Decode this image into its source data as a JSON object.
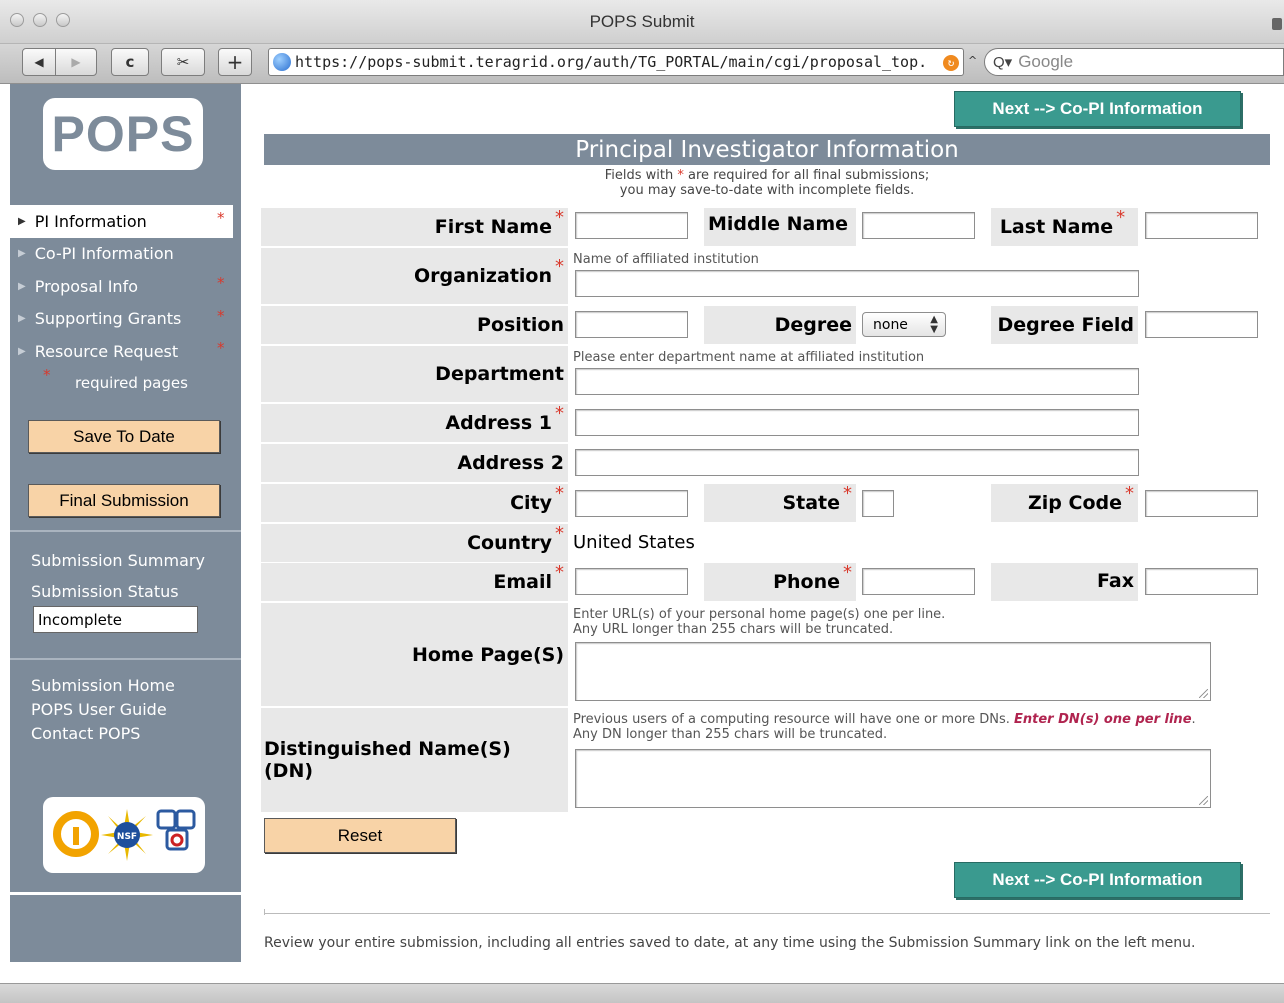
{
  "window": {
    "title": "POPS Submit"
  },
  "toolbar": {
    "back_glyph": "◀",
    "forward_glyph": "▶",
    "reload_glyph": "c",
    "snap_glyph": "✂",
    "add_glyph": "+",
    "url": "https://pops-submit.teragrid.org/auth/TG_PORTAL/main/cgi/proposal_top.",
    "search_placeholder": "Google",
    "search_glyph": "Q▾"
  },
  "sidebar": {
    "logo": "POPS",
    "nav": [
      {
        "label": "PI Information",
        "required": true,
        "active": true
      },
      {
        "label": "Co-PI Information",
        "required": false,
        "active": false
      },
      {
        "label": "Proposal Info",
        "required": true,
        "active": false
      },
      {
        "label": "Supporting Grants",
        "required": true,
        "active": false
      },
      {
        "label": "Resource Request",
        "required": true,
        "active": false
      }
    ],
    "required_star": "*",
    "required_note": "required pages",
    "save_button": "Save To Date",
    "final_button": "Final Submission",
    "summary_link": "Submission Summary",
    "status_label": "Submission Status",
    "status_value": "Incomplete",
    "home_link": "Submission Home",
    "guide_link": "POPS User Guide",
    "contact_link": "Contact POPS",
    "sponsor_nsf": "NSF"
  },
  "main": {
    "next_button": "Next --> Co-PI Information",
    "section_title": "Principal Investigator Information",
    "note_line1_a": "Fields with ",
    "note_star": "*",
    "note_line1_b": " are required for all final submissions;",
    "note_line2": "you may save-to-date with incomplete fields.",
    "labels": {
      "first_name": "First Name",
      "middle_name": "Middle Name",
      "last_name": "Last Name",
      "organization": "Organization",
      "position": "Position",
      "degree": "Degree",
      "degree_field": "Degree Field",
      "department": "Department",
      "address1": "Address 1",
      "address2": "Address 2",
      "city": "City",
      "state": "State",
      "zip": "Zip Code",
      "country": "Country",
      "email": "Email",
      "phone": "Phone",
      "fax": "Fax",
      "home_page": "Home Page(S)",
      "dn": "Distinguished Name(S) (DN)"
    },
    "star": "*",
    "hints": {
      "organization": "Name of affiliated institution",
      "department": "Please enter department name at affiliated institution",
      "home_page_1": "Enter URL(s) of your personal home page(s) one per line.",
      "home_page_2": "Any URL longer than 255 chars will be truncated.",
      "dn_1a": "Previous users of a computing resource will have one or more DNs. ",
      "dn_1b": "Enter DN(s) one per line",
      "dn_1c": ".",
      "dn_2": "Any DN longer than 255 chars will be truncated."
    },
    "degree_select": "none",
    "country_value": "United States",
    "reset_button": "Reset",
    "review_note": "Review your entire submission, including all entries saved to date, at any time using the Submission Summary link on the left menu."
  },
  "colors": {
    "sidebar_bg": "#7d8b9a",
    "accent_teal": "#3a9a8f",
    "button_peach": "#f8d3a7",
    "required_red": "#d9392c",
    "label_bg": "#e8e8e8"
  }
}
